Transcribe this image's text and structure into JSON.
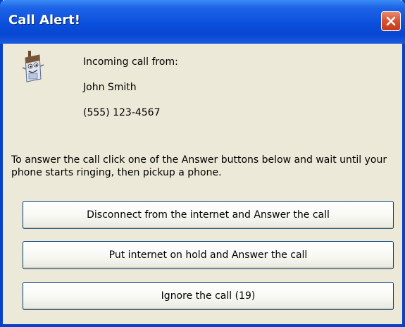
{
  "window": {
    "title": "Call Alert!",
    "close_icon": "close-icon"
  },
  "caller": {
    "label": "Incoming call from:",
    "name": "John Smith",
    "phone": "(555) 123-4567",
    "icon": "phone-mascot-icon"
  },
  "instructions": "To answer the call click one of the Answer buttons below and wait until your phone starts ringing, then pickup a phone.",
  "buttons": {
    "disconnect_answer": "Disconnect from the internet and Answer the call",
    "hold_answer": "Put internet on hold and Answer the call",
    "ignore": "Ignore the call (19)"
  },
  "colors": {
    "titlebar": "#0a4fdc",
    "window_bg": "#ece9d8",
    "close_button": "#d9502e",
    "button_border": "#003c74"
  }
}
